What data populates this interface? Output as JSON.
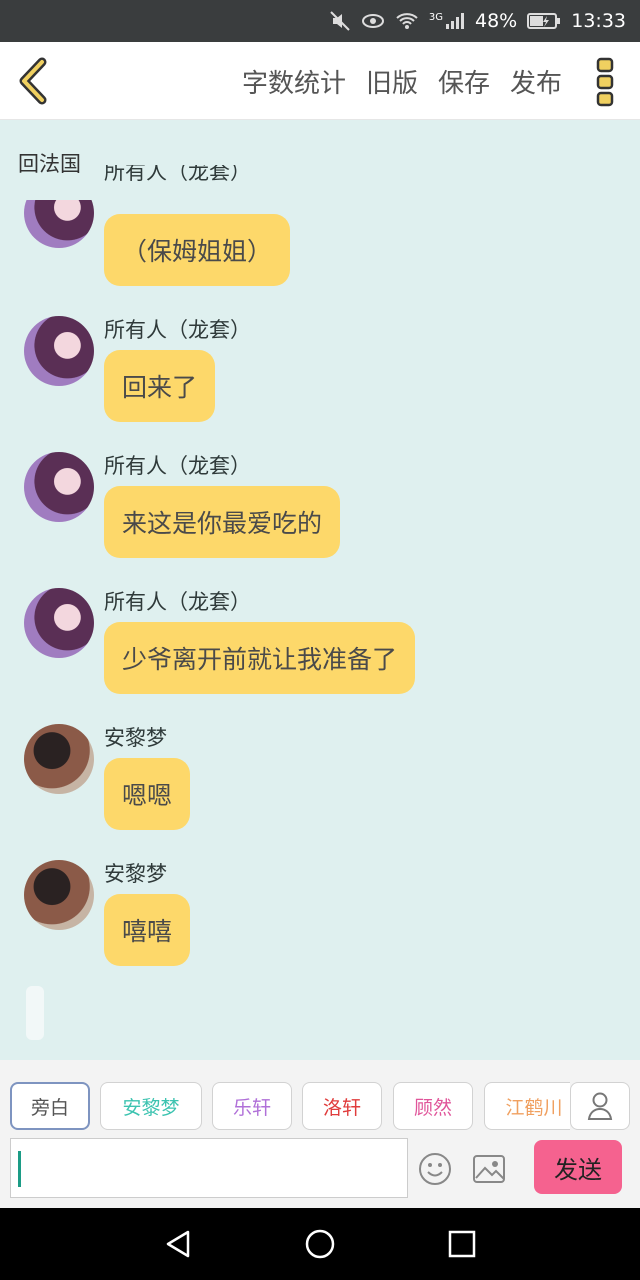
{
  "status_bar": {
    "network": "3G",
    "battery": "48%",
    "time": "13:33"
  },
  "toolbar": {
    "back_icon": "chevron-left-icon",
    "actions": [
      "字数统计",
      "旧版",
      "保存",
      "发布"
    ],
    "menu_icon": "vertical-dots-icon"
  },
  "chat": {
    "title": "回法国",
    "messages": [
      {
        "sender": "所有人（龙套）",
        "text": "（保姆姐姐）",
        "avatar": "purple-hair-girl-avatar"
      },
      {
        "sender": "所有人（龙套）",
        "text": "回来了",
        "avatar": "purple-hair-girl-avatar"
      },
      {
        "sender": "所有人（龙套）",
        "text": "来这是你最爱吃的",
        "avatar": "purple-hair-girl-avatar"
      },
      {
        "sender": "所有人（龙套）",
        "text": "少爷离开前就让我准备了",
        "avatar": "purple-hair-girl-avatar"
      },
      {
        "sender": "安黎梦",
        "text": "嗯嗯",
        "avatar": "braided-hair-girl-avatar"
      },
      {
        "sender": "安黎梦",
        "text": "嘻嘻",
        "avatar": "braided-hair-girl-avatar"
      }
    ]
  },
  "characters": [
    {
      "label": "旁白",
      "color": "#555555",
      "active": true
    },
    {
      "label": "安黎梦",
      "color": "#3cc3b0",
      "active": false
    },
    {
      "label": "乐轩",
      "color": "#b070d8",
      "active": false
    },
    {
      "label": "洛轩",
      "color": "#e03c3c",
      "active": false
    },
    {
      "label": "顾然",
      "color": "#e0559a",
      "active": false
    },
    {
      "label": "江鹤川",
      "color": "#f0a060",
      "active": false
    }
  ],
  "composer": {
    "input_value": "",
    "emoji_icon": "smiley-icon",
    "image_icon": "image-icon",
    "send_label": "发送",
    "send_color": "#f5628f",
    "user_icon": "person-icon"
  },
  "colors": {
    "chat_background": "#dff0ef",
    "bubble": "#fdd86a",
    "accent": "#f0d060"
  },
  "nav_bar": [
    "back-triangle-icon",
    "home-circle-icon",
    "recents-square-icon"
  ]
}
